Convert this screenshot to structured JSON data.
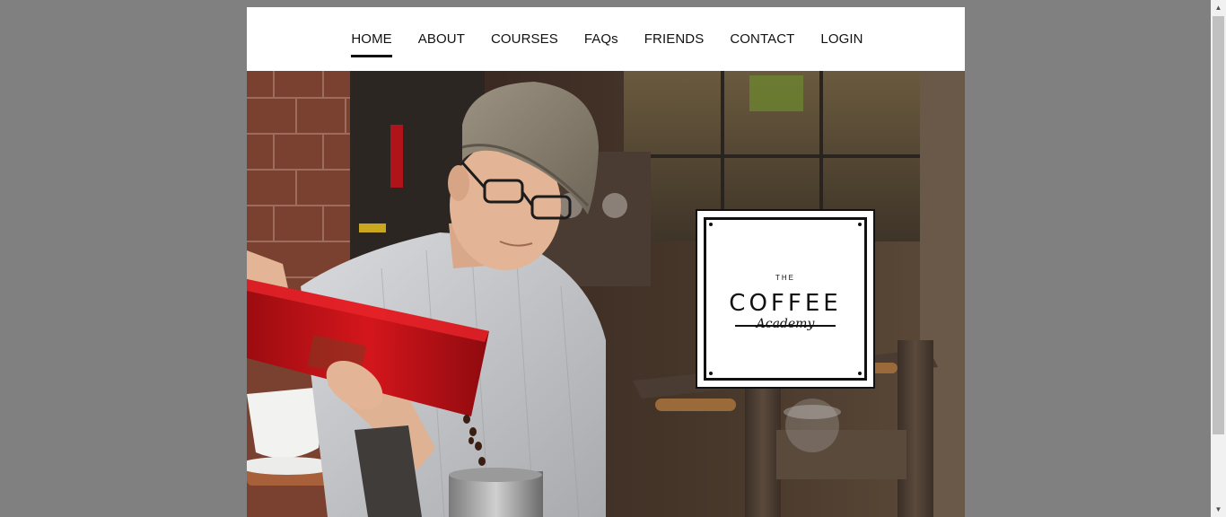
{
  "nav": {
    "items": [
      {
        "label": "HOME",
        "active": true
      },
      {
        "label": "ABOUT",
        "active": false
      },
      {
        "label": "COURSES",
        "active": false
      },
      {
        "label": "FAQs",
        "active": false
      },
      {
        "label": "FRIENDS",
        "active": false
      },
      {
        "label": "CONTACT",
        "active": false
      },
      {
        "label": "LOGIN",
        "active": false
      }
    ]
  },
  "hero": {
    "logo": {
      "the": "THE",
      "coffee": "COFFEE",
      "academy": "Academy"
    }
  },
  "colors": {
    "backdrop": "#808080",
    "nav_text": "#111111",
    "bag_red": "#c8141a"
  },
  "scrollbar": {
    "up_icon": "triangle-up",
    "down_icon": "triangle-down"
  }
}
